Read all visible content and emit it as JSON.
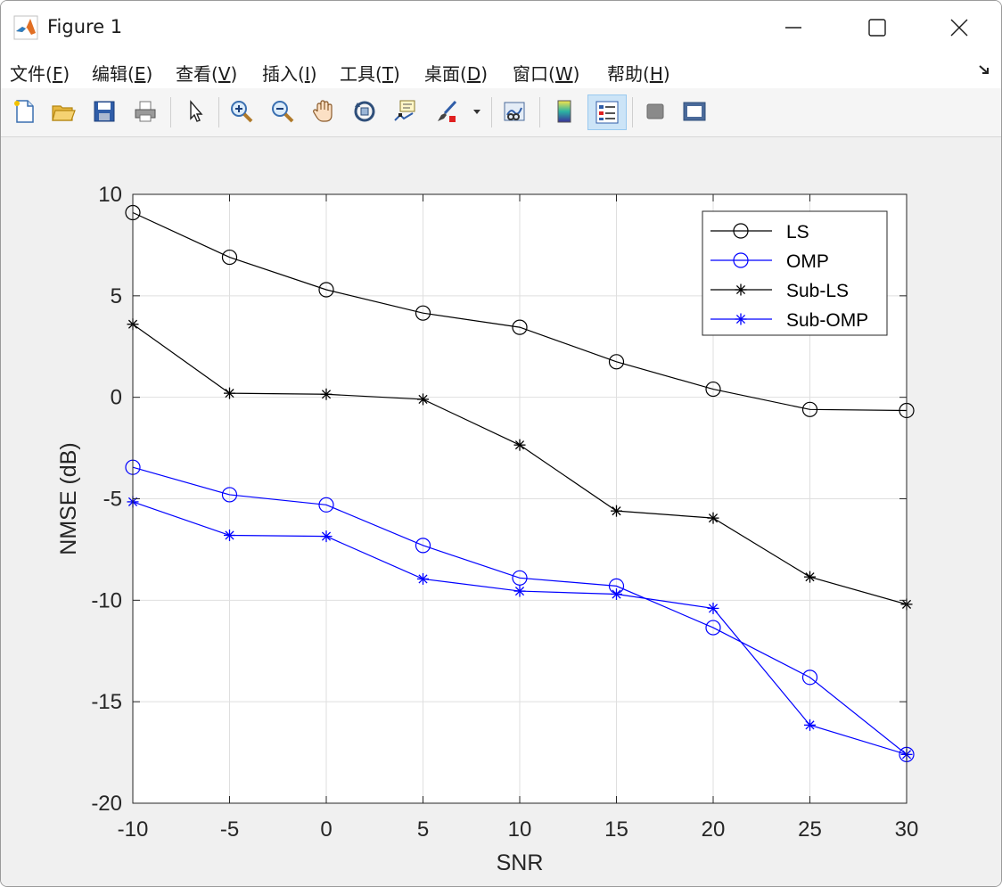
{
  "window": {
    "title": "Figure 1"
  },
  "menu": [
    {
      "pre": "文件(",
      "key": "F",
      "post": ")"
    },
    {
      "pre": "编辑(",
      "key": "E",
      "post": ")"
    },
    {
      "pre": "查看(",
      "key": "V",
      "post": ")"
    },
    {
      "pre": "插入(",
      "key": "I",
      "post": ")"
    },
    {
      "pre": "工具(",
      "key": "T",
      "post": ")"
    },
    {
      "pre": "桌面(",
      "key": "D",
      "post": ")"
    },
    {
      "pre": "窗口(",
      "key": "W",
      "post": ")"
    },
    {
      "pre": "帮助(",
      "key": "H",
      "post": ")"
    }
  ],
  "toolbar": [
    "new-figure-icon",
    "open-file-icon",
    "save-icon",
    "print-icon",
    "select-arrow-icon",
    "zoom-in-icon",
    "zoom-out-icon",
    "pan-hand-icon",
    "rotate-3d-icon",
    "data-cursor-icon",
    "brush-icon",
    "link-plot-icon",
    "colorbar-icon",
    "legend-icon",
    "hide-plot-tools-icon",
    "show-plot-tools-icon"
  ],
  "chart_data": {
    "type": "line",
    "title": "",
    "xlabel": "SNR",
    "ylabel": "NMSE (dB)",
    "xlim": [
      -10,
      30
    ],
    "ylim": [
      -20,
      10
    ],
    "xticks": [
      -10,
      -5,
      0,
      5,
      10,
      15,
      20,
      25,
      30
    ],
    "yticks": [
      10,
      5,
      0,
      -5,
      -10,
      -15,
      -20
    ],
    "grid": true,
    "legend_position": "top-right",
    "x": [
      -10,
      -5,
      0,
      5,
      10,
      15,
      20,
      25,
      30
    ],
    "series": [
      {
        "name": "LS",
        "color": "#000000",
        "marker": "circle",
        "values": [
          9.1,
          6.9,
          5.3,
          4.15,
          3.45,
          1.75,
          0.4,
          -0.6,
          -0.65
        ]
      },
      {
        "name": "OMP",
        "color": "#0000ff",
        "marker": "circle",
        "values": [
          -3.45,
          -4.8,
          -5.3,
          -7.3,
          -8.9,
          -9.3,
          -11.35,
          -13.8,
          -17.6
        ]
      },
      {
        "name": "Sub-LS",
        "color": "#000000",
        "marker": "asterisk",
        "values": [
          3.6,
          0.2,
          0.15,
          -0.1,
          -2.35,
          -5.6,
          -5.95,
          -8.85,
          -10.2
        ]
      },
      {
        "name": "Sub-OMP",
        "color": "#0000ff",
        "marker": "asterisk",
        "values": [
          -5.15,
          -6.8,
          -6.85,
          -8.95,
          -9.55,
          -9.7,
          -10.4,
          -16.15,
          -17.6
        ]
      }
    ]
  }
}
